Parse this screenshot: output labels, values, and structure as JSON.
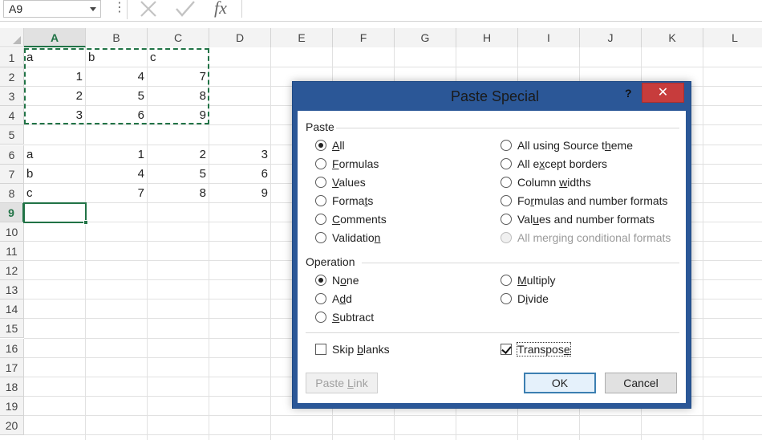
{
  "formula_bar": {
    "name_box": "A9",
    "more_glyph": "⋮",
    "fx_label": "fx",
    "formula_value": ""
  },
  "sheet": {
    "columns": [
      "A",
      "B",
      "C",
      "D",
      "E",
      "F",
      "G",
      "H",
      "I",
      "J",
      "K",
      "L"
    ],
    "selected_column": "A",
    "rows": [
      "1",
      "2",
      "3",
      "4",
      "5",
      "6",
      "7",
      "8",
      "9",
      "10",
      "11",
      "12",
      "13",
      "14",
      "15",
      "16",
      "17",
      "18",
      "19",
      "20"
    ],
    "selected_row": "9",
    "cells": {
      "A1": "a",
      "B1": "b",
      "C1": "c",
      "A2": "1",
      "B2": "4",
      "C2": "7",
      "A3": "2",
      "B3": "5",
      "C3": "8",
      "A4": "3",
      "B4": "6",
      "C4": "9",
      "A6": "a",
      "B6": "1",
      "C6": "2",
      "D6": "3",
      "A7": "b",
      "B7": "4",
      "C7": "5",
      "D7": "6",
      "A8": "c",
      "B8": "7",
      "C8": "8",
      "D8": "9"
    },
    "accent_color": "#217346"
  },
  "dialog": {
    "title": "Paste Special",
    "help": "?",
    "close": "✕",
    "title_bar_color": "#2b5797",
    "paste_group": {
      "label": "Paste",
      "options_left": [
        {
          "pre": "",
          "key": "A",
          "post": "ll",
          "checked": true
        },
        {
          "pre": "",
          "key": "F",
          "post": "ormulas",
          "checked": false
        },
        {
          "pre": "",
          "key": "V",
          "post": "alues",
          "checked": false
        },
        {
          "pre": "Forma",
          "key": "t",
          "post": "s",
          "checked": false
        },
        {
          "pre": "",
          "key": "C",
          "post": "omments",
          "checked": false
        },
        {
          "pre": "Validatio",
          "key": "n",
          "post": "",
          "checked": false
        }
      ],
      "options_right": [
        {
          "pre": "All using Source t",
          "key": "h",
          "post": "eme",
          "checked": false,
          "disabled": false
        },
        {
          "pre": "All e",
          "key": "x",
          "post": "cept borders",
          "checked": false,
          "disabled": false
        },
        {
          "pre": "Column ",
          "key": "w",
          "post": "idths",
          "checked": false,
          "disabled": false
        },
        {
          "pre": "Fo",
          "key": "r",
          "post": "mulas and number formats",
          "checked": false,
          "disabled": false
        },
        {
          "pre": "Val",
          "key": "u",
          "post": "es and number formats",
          "checked": false,
          "disabled": false
        },
        {
          "pre": "All mer",
          "key": "g",
          "post": "ing conditional formats",
          "checked": false,
          "disabled": true
        }
      ]
    },
    "operation_group": {
      "label": "Operation",
      "options_left": [
        {
          "pre": "N",
          "key": "o",
          "post": "ne",
          "checked": true
        },
        {
          "pre": "A",
          "key": "d",
          "post": "d",
          "checked": false
        },
        {
          "pre": "",
          "key": "S",
          "post": "ubtract",
          "checked": false
        }
      ],
      "options_right": [
        {
          "pre": "",
          "key": "M",
          "post": "ultiply",
          "checked": false
        },
        {
          "pre": "D",
          "key": "i",
          "post": "vide",
          "checked": false
        }
      ]
    },
    "skip_blanks": {
      "pre": "Skip ",
      "key": "b",
      "post": "lanks",
      "checked": false
    },
    "transpose": {
      "pre": "Transpos",
      "key": "e",
      "post": "",
      "checked": true
    },
    "buttons": {
      "paste_link": {
        "pre": "Paste ",
        "key": "L",
        "post": "ink"
      },
      "ok": "OK",
      "cancel": "Cancel"
    }
  }
}
